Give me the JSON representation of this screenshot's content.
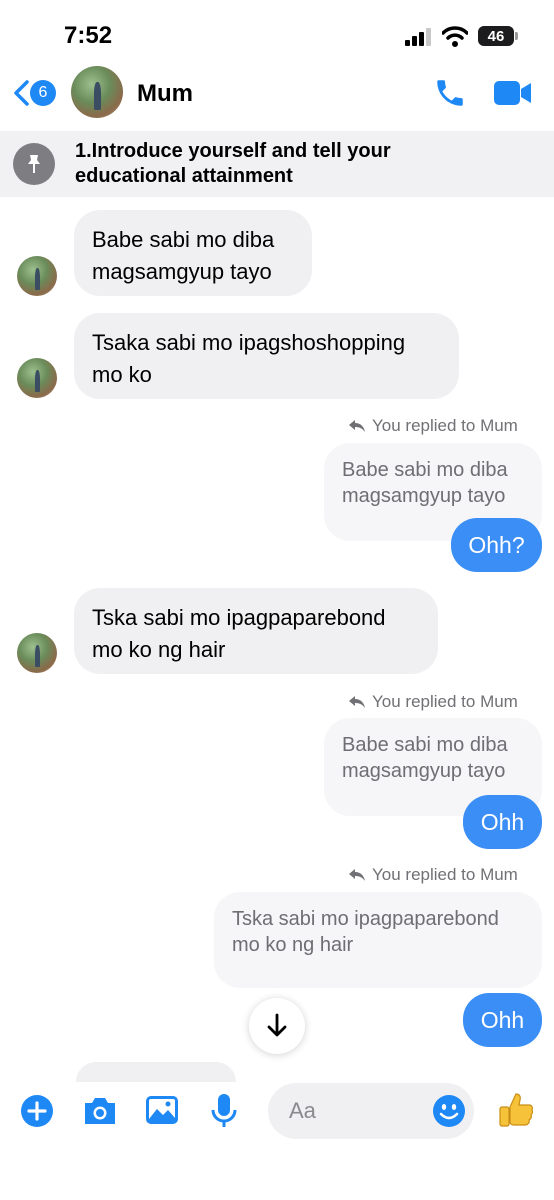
{
  "status_bar": {
    "time": "7:52",
    "battery": "46"
  },
  "header": {
    "back_count": "6",
    "contact_name": "Mum"
  },
  "pinned": {
    "text": "1.Introduce yourself and tell your educational attainment"
  },
  "messages": {
    "in1": "Babe sabi mo diba magsamgyup tayo",
    "in2": "Tsaka sabi mo ipagshoshopping mo ko",
    "reply1": {
      "label": "You replied to Mum",
      "quote": "Babe sabi mo diba magsamgyup tayo",
      "text": "Ohh?"
    },
    "in3": "Tska sabi mo ipagpaparebond mo ko ng hair",
    "reply2": {
      "label": "You replied to Mum",
      "quote": "Babe sabi mo diba magsamgyup tayo",
      "text": "Ohh"
    },
    "reply3": {
      "label": "You replied to Mum",
      "quote": "Tska sabi mo ipagpaparebond mo ko ng hair",
      "text": "Ohh"
    }
  },
  "composer": {
    "placeholder": "Aa"
  },
  "colors": {
    "accent": "#3a8ef6",
    "incoming_bubble": "#f0f0f2",
    "pinned_bg": "#f1f1f3"
  }
}
